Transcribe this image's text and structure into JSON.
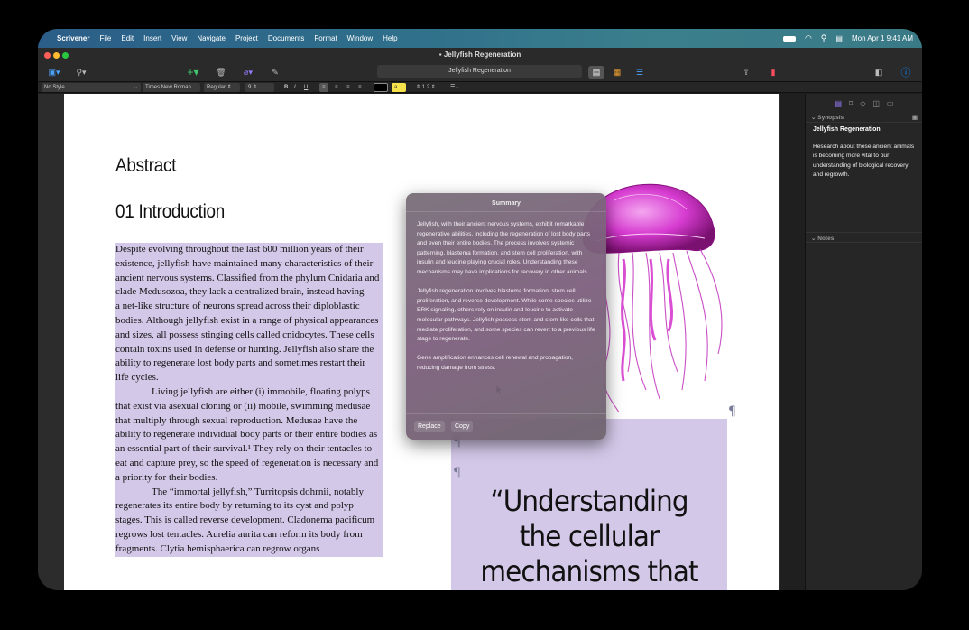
{
  "menubar": {
    "apple": "",
    "items": [
      "Scrivener",
      "File",
      "Edit",
      "Insert",
      "View",
      "Navigate",
      "Project",
      "Documents",
      "Format",
      "Window",
      "Help"
    ],
    "datetime": "Mon Apr 1  9:41 AM"
  },
  "window": {
    "title": "Jellyfish Regeneration"
  },
  "toolbar": {
    "document_field": "Jellyfish Regeneration"
  },
  "formatbar": {
    "style": "No Style",
    "font": "Times New Roman",
    "weight": "Regular",
    "size": "9",
    "bold": "B",
    "italic": "I",
    "underline": "U",
    "highlight": "a",
    "line_spacing": "1.2"
  },
  "document": {
    "heading_abstract": "Abstract",
    "heading_intro": "01 Introduction",
    "paragraphs": [
      "Despite evolving throughout the last 600 million years of their existence, jellyfish have maintained many characteristics of their ancient nervous systems. Classified from the phylum Cnidaria and clade Medusozoa, they lack a centralized brain, instead having",
      "a net-like structure of neurons spread across their diploblastic bodies. Although jellyfish exist in a range of physical appearances and sizes, all possess stinging cells called cnidocytes. These cells contain toxins used in defense or hunting. Jellyfish also share the ability to regenerate lost body parts and sometimes restart their",
      "life cycles.",
      "Living jellyfish are either (i) immobile, floating polyps that exist via asexual cloning or (ii) mobile, swimming medusae that multiply through sexual reproduction. Medusae have the ability to regenerate individual body parts or their entire bodies as an essential part of their survival.¹ They rely on their tentacles to eat and capture prey, so the speed of regeneration is necessary and a priority for their bodies.",
      "The “immortal jellyfish,” Turritopsis dohrnii, notably regenerates its entire body by returning to its cyst and polyp stages. This is called reverse development. Cladonema pacificum regrows lost tentacles. Aurelia aurita can reform its body from fragments. Clytia hemisphaerica can regrow organs"
    ],
    "quote": "“Understanding the cellular mechanisms that lead to jellyfish",
    "pilcrow": "¶"
  },
  "summary": {
    "title": "Summary",
    "paragraphs": [
      "Jellyfish, with their ancient nervous systems, exhibit remarkable regenerative abilities, including the regeneration of lost body parts and even their entire bodies. The process involves systemic patterning, blastema formation, and stem cell proliferation, with insulin and leucine playing crucial roles. Understanding these mechanisms may have implications for recovery in other animals.",
      "Jellyfish regeneration involves blastema formation, stem cell proliferation, and reverse development. While some species utilize ERK signaling, others rely on insulin and leucine to activate molecular pathways. Jellyfish possess stem and stem-like cells that mediate proliferation, and some species can revert to a previous life stage to regenerate.",
      "Gene amplification enhances cell renewal and propagation, reducing damage from stress."
    ],
    "replace_label": "Replace",
    "copy_label": "Copy"
  },
  "inspector": {
    "synopsis_label": "Synopsis",
    "synopsis_title": "Jellyfish Regeneration",
    "synopsis_text": "Research about these ancient animals is becoming more vital to our understanding of biological recovery and regrowth.",
    "notes_label": "Notes"
  },
  "colors": {
    "highlight": "#d4c8e8",
    "accent": "#0a84ff",
    "jellyfish": "#d63bd0"
  }
}
